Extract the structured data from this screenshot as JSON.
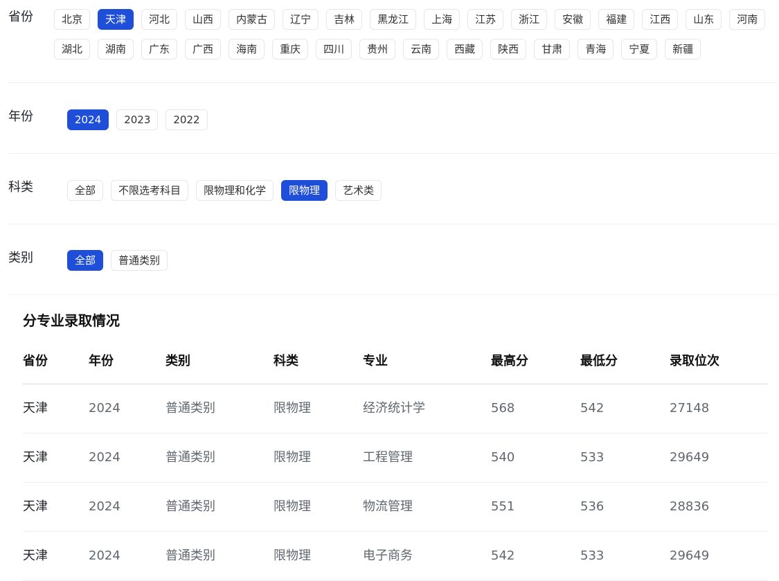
{
  "filters": {
    "province": {
      "label": "省份",
      "options": [
        "北京",
        "天津",
        "河北",
        "山西",
        "内蒙古",
        "辽宁",
        "吉林",
        "黑龙江",
        "上海",
        "江苏",
        "浙江",
        "安徽",
        "福建",
        "江西",
        "山东",
        "河南",
        "湖北",
        "湖南",
        "广东",
        "广西",
        "海南",
        "重庆",
        "四川",
        "贵州",
        "云南",
        "西藏",
        "陕西",
        "甘肃",
        "青海",
        "宁夏",
        "新疆"
      ],
      "selected": "天津"
    },
    "year": {
      "label": "年份",
      "options": [
        "2024",
        "2023",
        "2022"
      ],
      "selected": "2024"
    },
    "subject": {
      "label": "科类",
      "options": [
        "全部",
        "不限选考科目",
        "限物理和化学",
        "限物理",
        "艺术类"
      ],
      "selected": "限物理"
    },
    "category": {
      "label": "类别",
      "options": [
        "全部",
        "普通类别"
      ],
      "selected": "全部"
    }
  },
  "section": {
    "title": "分专业录取情况"
  },
  "table": {
    "columns": [
      "省份",
      "年份",
      "类别",
      "科类",
      "专业",
      "最高分",
      "最低分",
      "录取位次"
    ],
    "rows": [
      [
        "天津",
        "2024",
        "普通类别",
        "限物理",
        "经济统计学",
        "568",
        "542",
        "27148"
      ],
      [
        "天津",
        "2024",
        "普通类别",
        "限物理",
        "工程管理",
        "540",
        "533",
        "29649"
      ],
      [
        "天津",
        "2024",
        "普通类别",
        "限物理",
        "物流管理",
        "551",
        "536",
        "28836"
      ],
      [
        "天津",
        "2024",
        "普通类别",
        "限物理",
        "电子商务",
        "542",
        "533",
        "29649"
      ]
    ]
  },
  "colors": {
    "accent": "#1f4fd8",
    "chip_border": "#e4e7ed",
    "muted_text": "#606770"
  }
}
